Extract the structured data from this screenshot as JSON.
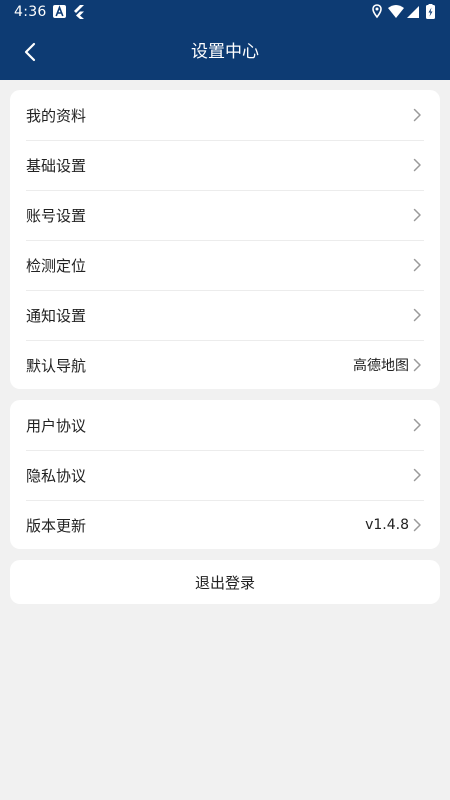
{
  "status_bar": {
    "time": "4:36"
  },
  "header": {
    "title": "设置中心",
    "background_color": "#0d3b73"
  },
  "settings_group_1": [
    {
      "label": "我的资料",
      "value": ""
    },
    {
      "label": "基础设置",
      "value": ""
    },
    {
      "label": "账号设置",
      "value": ""
    },
    {
      "label": "检测定位",
      "value": ""
    },
    {
      "label": "通知设置",
      "value": ""
    },
    {
      "label": "默认导航",
      "value": "高德地图"
    }
  ],
  "settings_group_2": [
    {
      "label": "用户协议",
      "value": ""
    },
    {
      "label": "隐私协议",
      "value": ""
    },
    {
      "label": "版本更新",
      "value": "v1.4.8"
    }
  ],
  "logout": {
    "label": "退出登录"
  },
  "icons": {
    "back": "chevron-left-icon",
    "row_arrow": "chevron-right-icon"
  }
}
